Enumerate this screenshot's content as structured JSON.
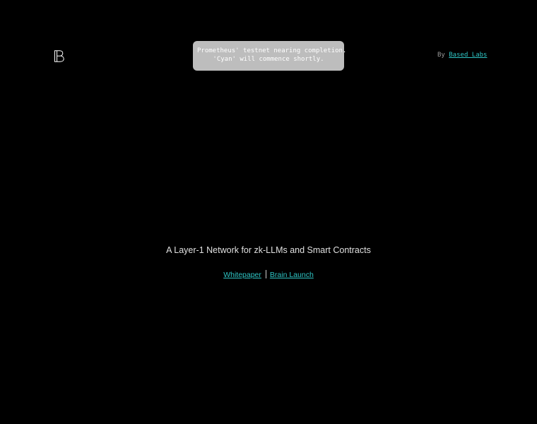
{
  "header": {
    "logo_icon": "based-b-logo-icon",
    "notice": {
      "line1": "Prometheus' testnet nearing completion.",
      "line2": "'Cyan' will commence shortly."
    },
    "byline": {
      "prefix": "By",
      "link_label": "Based Labs"
    }
  },
  "hero": {
    "tagline": "A Layer-1 Network for zk-LLMs and Smart Contracts",
    "links": [
      {
        "label": "Whitepaper"
      },
      {
        "label": "Brain Launch"
      }
    ]
  },
  "colors": {
    "background": "#000000",
    "accent_link": "#2ec4c4",
    "notice_bg": "#bdbdbd"
  }
}
